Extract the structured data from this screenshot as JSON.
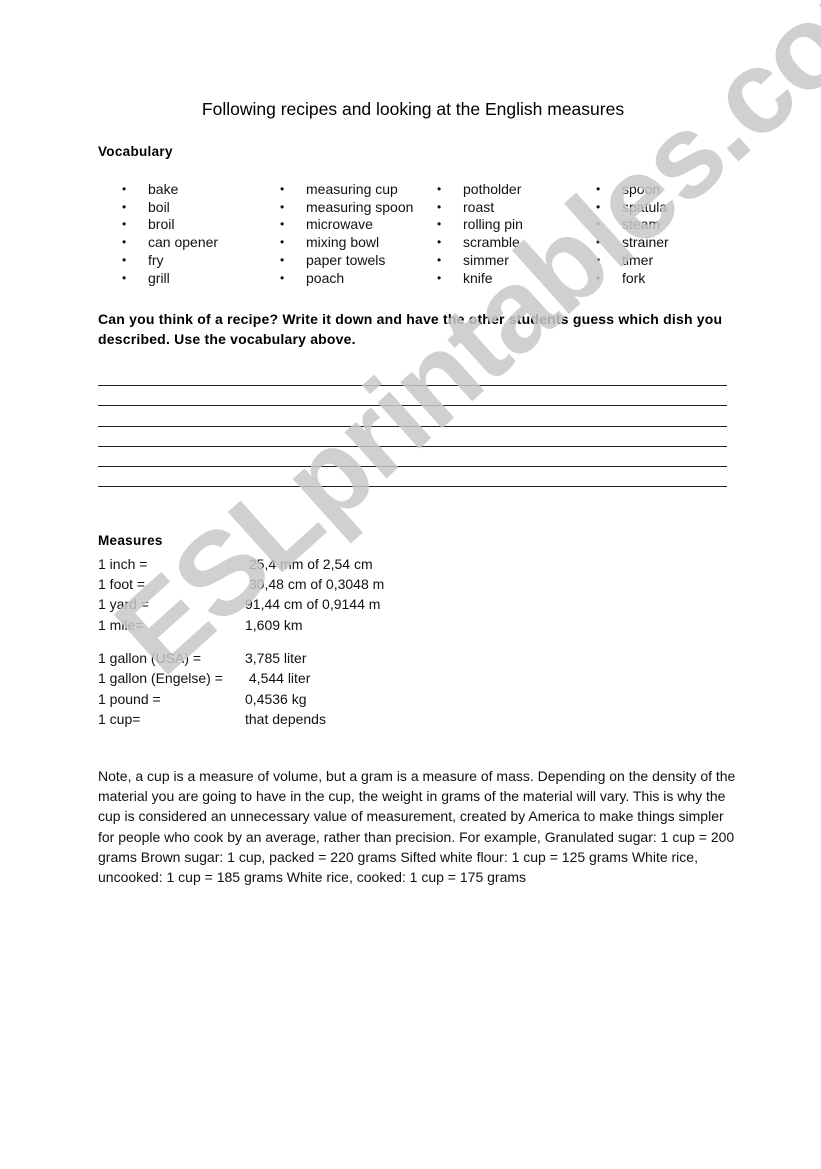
{
  "title": "Following recipes and looking at the English measures",
  "vocabulary": {
    "heading": "Vocabulary",
    "bullet": "•",
    "columns": [
      [
        "bake",
        "boil",
        "broil",
        "can opener",
        "fry",
        "grill"
      ],
      [
        "measuring cup",
        "measuring spoon",
        "microwave",
        "mixing bowl",
        "paper towels",
        "poach"
      ],
      [
        "potholder",
        "roast",
        "rolling pin",
        "scramble",
        "simmer",
        "knife"
      ],
      [
        "spoon",
        "spatula",
        "steam",
        "strainer",
        "timer",
        "fork"
      ]
    ]
  },
  "prompt": "Can you think of a recipe? Write it down and have the other students guess which dish you described. Use the vocabulary above.",
  "writing_lines_count": 6,
  "measures": {
    "heading": "Measures",
    "length": [
      {
        "unit": "1 inch =",
        "value": " 25,4 mm of 2,54 cm"
      },
      {
        "unit": "1 foot =",
        "value": " 30,48 cm of 0,3048 m"
      },
      {
        "unit": "1 yard =",
        "value": "91,44 cm of 0,9144 m"
      },
      {
        "unit": "1 mile=",
        "value": "1,609 km"
      }
    ],
    "volume_mass": [
      {
        "unit": "1 gallon (USA) =",
        "value": "3,785 liter"
      },
      {
        "unit": "1 gallon (Engelse) =",
        "value": " 4,544 liter"
      },
      {
        "unit": "1 pound =",
        "value": "0,4536 kg"
      },
      {
        "unit": "1 cup=",
        "value": "that depends"
      }
    ]
  },
  "note": "Note, a cup is a measure of volume, but a gram is a measure of mass. Depending on the density of the material you are going to have in the cup, the weight in grams of the material will vary. This is why the cup is considered an unnecessary value of measurement, created by America to make things simpler for people who cook by an average, rather than precision. For example, Granulated sugar: 1 cup = 200 grams Brown sugar: 1 cup, packed = 220 grams Sifted white flour: 1 cup = 125 grams  White rice, uncooked: 1 cup = 185 grams White rice, cooked: 1 cup = 175 grams",
  "watermark": "ESLprintables.com"
}
